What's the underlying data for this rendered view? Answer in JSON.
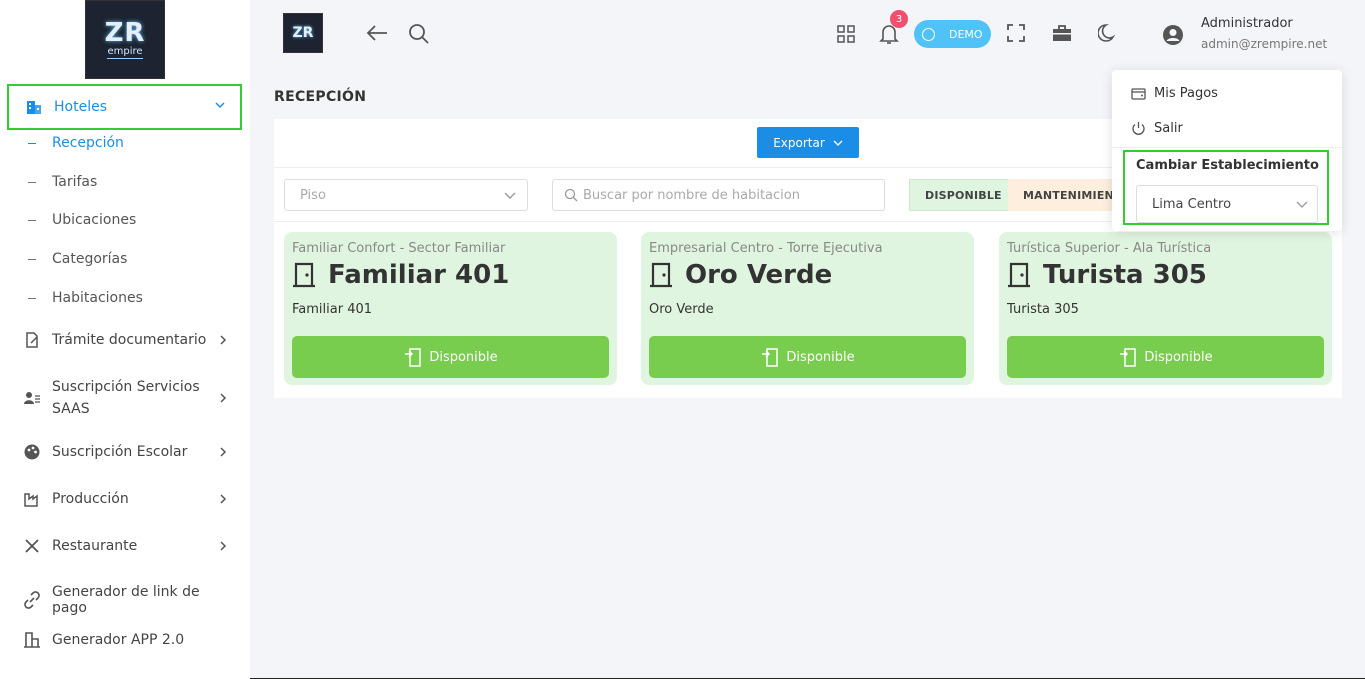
{
  "logo": {
    "line1": "ZR",
    "line2": "empire"
  },
  "sidebar": {
    "active_section": {
      "label": "Hoteles"
    },
    "sub_items": [
      {
        "label": "Recepción",
        "active": true
      },
      {
        "label": "Tarifas"
      },
      {
        "label": "Ubicaciones"
      },
      {
        "label": "Categorías"
      },
      {
        "label": "Habitaciones"
      }
    ],
    "items": [
      {
        "label": "Trámite documentario",
        "icon": "document-edit-icon"
      },
      {
        "label": "Suscripción Servicios SAAS",
        "icon": "user-list-icon"
      },
      {
        "label": "Suscripción Escolar",
        "icon": "palette-icon"
      },
      {
        "label": "Producción",
        "icon": "factory-icon"
      },
      {
        "label": "Restaurante",
        "icon": "utensils-icon"
      },
      {
        "label": "Generador de link de pago",
        "icon": "link-icon"
      },
      {
        "label": "Generador APP 2.0",
        "icon": "building-icon"
      }
    ]
  },
  "topbar": {
    "notifications_count": "3",
    "demo_label": "DEMO",
    "user_name": "Administrador",
    "user_email": "admin@zrempire.net"
  },
  "page": {
    "title": "RECEPCIÓN"
  },
  "toolbar": {
    "export_label": "Exportar",
    "floor_placeholder": "Piso",
    "search_placeholder": "Buscar por nombre de habitacion",
    "filters": [
      "DISPONIBLE",
      "MANTENIMIENTO"
    ]
  },
  "rooms": [
    {
      "category": "Familiar Confort - Sector Familiar",
      "title": "Familiar 401",
      "name": "Familiar 401",
      "status": "Disponible"
    },
    {
      "category": "Empresarial Centro - Torre Ejecutiva",
      "title": "Oro Verde",
      "name": "Oro Verde",
      "status": "Disponible"
    },
    {
      "category": "Turística Superior - Ala Turística",
      "title": "Turista 305",
      "name": "Turista 305",
      "status": "Disponible"
    }
  ],
  "dropdown": {
    "items": [
      {
        "label": "Mis Pagos",
        "icon": "wallet-icon"
      },
      {
        "label": "Salir",
        "icon": "power-icon"
      }
    ],
    "establishment_heading": "Cambiar Establecimiento",
    "establishment_value": "Lima Centro"
  },
  "colors": {
    "accent": "#1a8ee6",
    "room_card_bg": "#e0f5e0",
    "status_green": "#78cc4e",
    "highlight_border": "#33cc33",
    "badge": "#f0506e"
  }
}
